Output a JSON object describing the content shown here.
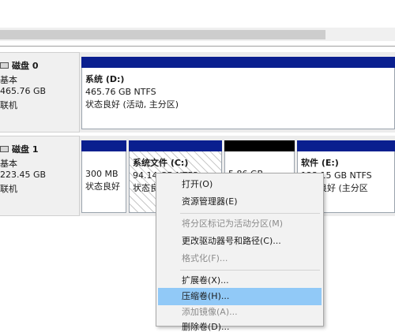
{
  "disks": [
    {
      "name": "磁盘 0",
      "type": "基本",
      "size": "465.76 GB",
      "status": "联机",
      "partitions": [
        {
          "name": "系统  (D:)",
          "size": "465.76 GB NTFS",
          "status": "状态良好 (活动, 主分区)",
          "bar_color": "#0a1f8f"
        }
      ]
    },
    {
      "name": "磁盘 1",
      "type": "基本",
      "size": "223.45 GB",
      "status": "联机",
      "partitions": [
        {
          "name": "",
          "size": "300 MB",
          "status": "状态良好",
          "bar_color": "#0a1f8f"
        },
        {
          "name": "系统文件  (C:)",
          "size": "94.14 GB NTFS",
          "status": "状态良",
          "bar_color": "#0a1f8f",
          "selected": true
        },
        {
          "name": "",
          "size": "5.86 GB",
          "status": "",
          "bar_color": "#000000"
        },
        {
          "name": "软件  (E:)",
          "size": "123.15 GB NTFS",
          "status": "状态良好 (主分区",
          "bar_color": "#0a1f8f"
        }
      ]
    }
  ],
  "context_menu": {
    "items": [
      {
        "label": "打开(O)",
        "enabled": true
      },
      {
        "label": "资源管理器(E)",
        "enabled": true
      },
      {
        "label": "将分区标记为活动分区(M)",
        "enabled": false
      },
      {
        "label": "更改驱动器号和路径(C)...",
        "enabled": true
      },
      {
        "label": "格式化(F)...",
        "enabled": false
      },
      {
        "label": "扩展卷(X)...",
        "enabled": true
      },
      {
        "label": "压缩卷(H)...",
        "enabled": true,
        "highlighted": true
      },
      {
        "label": "添加镜像(A)...",
        "enabled": false
      },
      {
        "label": "删除卷(D)...",
        "enabled": true
      }
    ]
  },
  "colors": {
    "primary_partition_bar": "#0a1f8f",
    "unallocated_bar": "#000000",
    "menu_highlight": "#91c9f7"
  }
}
